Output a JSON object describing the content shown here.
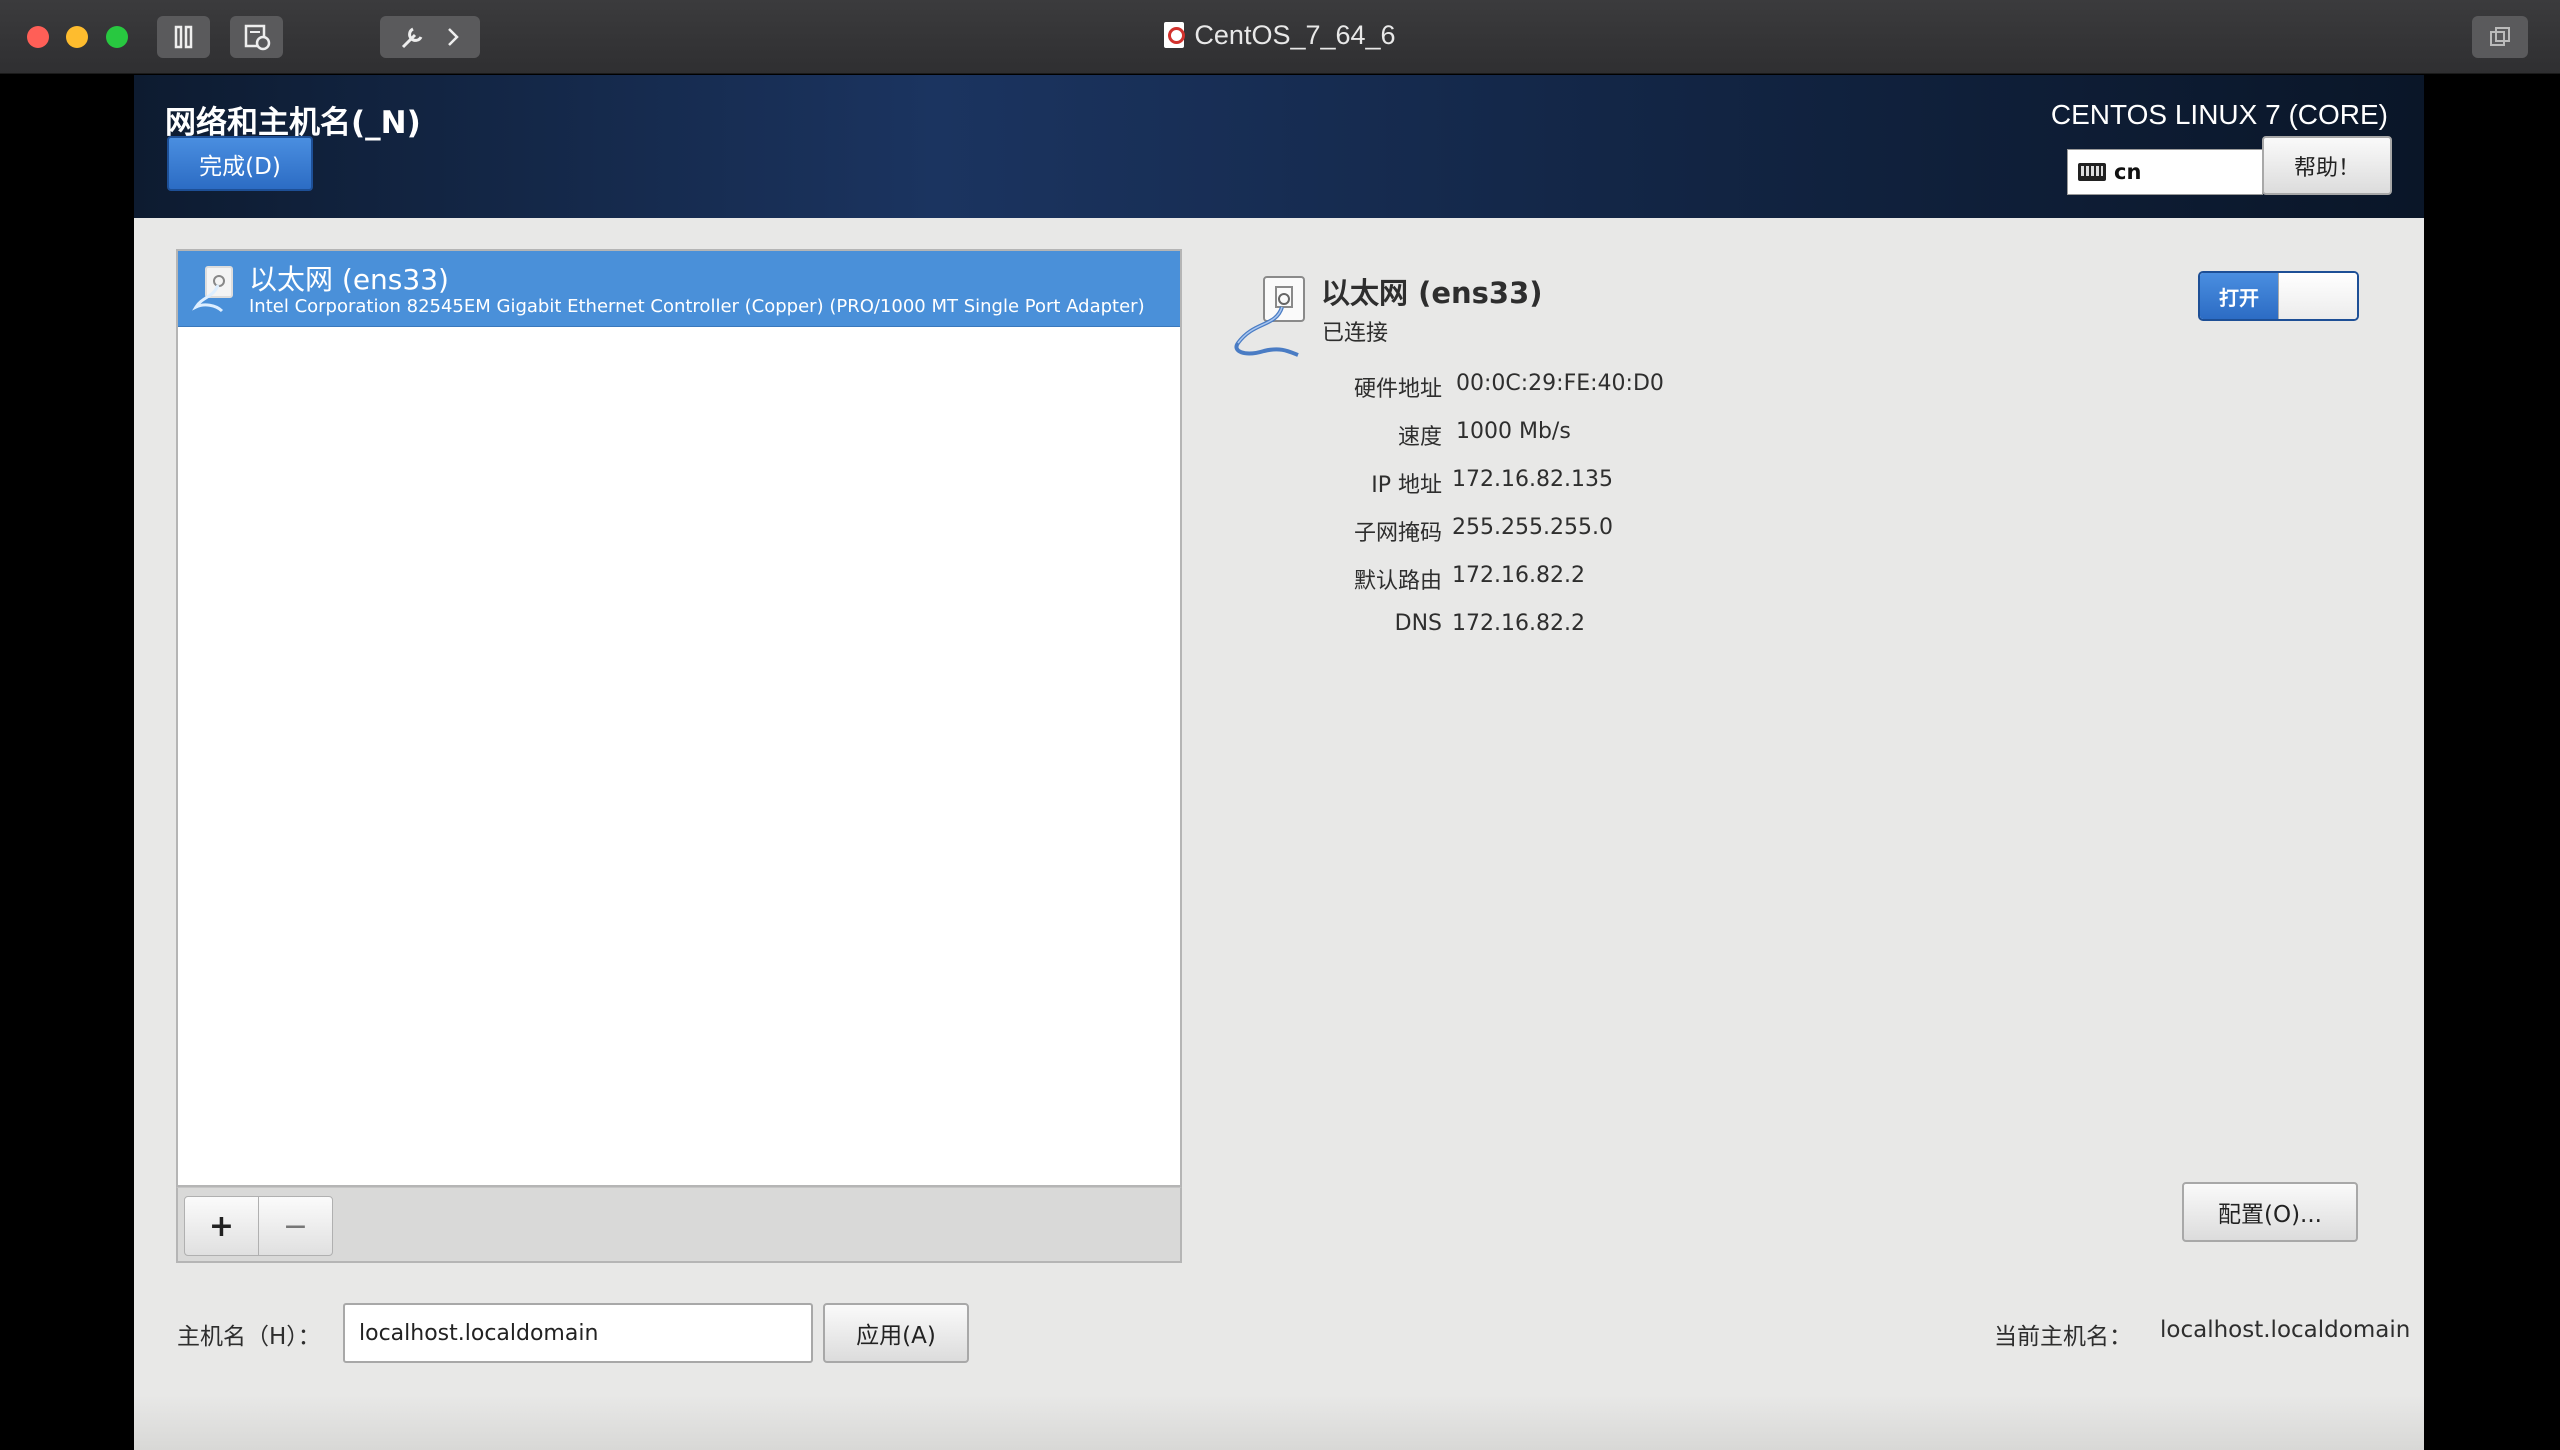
{
  "window": {
    "title": "CentOS_7_64_6"
  },
  "header": {
    "title": "网络和主机名(_N)",
    "done_label": "完成(D)",
    "product": "CENTOS LINUX 7 (CORE)",
    "keyboard_layout": "cn",
    "help_label": "帮助！"
  },
  "device_list": {
    "items": [
      {
        "name": "以太网 (ens33)",
        "description": "Intel Corporation 82545EM Gigabit Ethernet Controller (Copper) (PRO/1000 MT Single Port Adapter)"
      }
    ],
    "add_label": "+",
    "remove_label": "−"
  },
  "device": {
    "name": "以太网 (ens33)",
    "status": "已连接",
    "switch_label": "打开",
    "details": [
      {
        "label": "硬件地址",
        "value": "00:0C:29:FE:40:D0"
      },
      {
        "label": "速度",
        "value": "1000 Mb/s"
      },
      {
        "label": "IP 地址",
        "value": "172.16.82.135"
      },
      {
        "label": "子网掩码",
        "value": "255.255.255.0"
      },
      {
        "label": "默认路由",
        "value": "172.16.82.2"
      },
      {
        "label": "DNS",
        "value": "172.16.82.2"
      }
    ],
    "configure_label": "配置(O)..."
  },
  "hostname": {
    "label": "主机名（H）：",
    "value": "localhost.localdomain",
    "apply_label": "应用(A)",
    "current_label": "当前主机名：",
    "current_value": "localhost.localdomain"
  },
  "colors": {
    "accent": "#4a90d9",
    "header_bg": "#14284a",
    "panel_bg": "#e8e8e7"
  }
}
